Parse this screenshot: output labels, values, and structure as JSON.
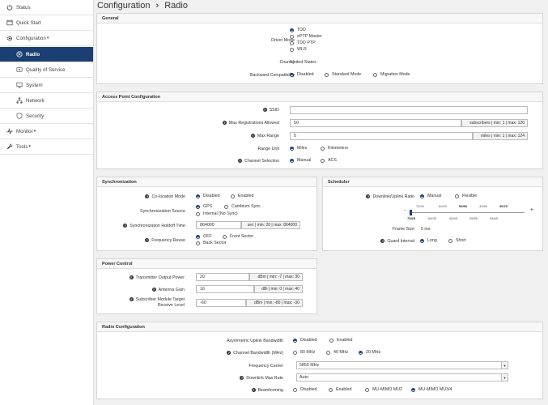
{
  "sidebar": {
    "items": [
      {
        "label": "Status",
        "icon": "power-icon"
      },
      {
        "label": "Quick Start",
        "icon": "window-icon"
      },
      {
        "label": "Configuration",
        "icon": "gear-icon"
      },
      {
        "label": "Radio",
        "icon": "radio-icon"
      },
      {
        "label": "Quality of Service",
        "icon": "qos-icon"
      },
      {
        "label": "System",
        "icon": "monitor-icon"
      },
      {
        "label": "Network",
        "icon": "network-icon"
      },
      {
        "label": "Security",
        "icon": "shield-icon"
      },
      {
        "label": "Monitor",
        "icon": "chart-icon"
      },
      {
        "label": "Tools",
        "icon": "wrench-icon"
      }
    ],
    "caret": "▾"
  },
  "page": {
    "title": "Configuration",
    "sep": "›",
    "subtitle": "Radio"
  },
  "general": {
    "title": "General",
    "driver_mode_label": "Driver Mode",
    "driver_modes": [
      "TDD",
      "ePTP Master",
      "TDD PTP",
      "WLR"
    ],
    "country_label": "Country",
    "country_value": "United States",
    "backward_label": "Backward Compatibility",
    "backward_opts": [
      "Disabled",
      "Standard Mode",
      "Migration Mode"
    ]
  },
  "ap": {
    "title": "Access Point Configuration",
    "ssid_label": "SSID",
    "ssid_value": "",
    "maxreg_label": "Max Registrations Allowed",
    "maxreg_value": "50",
    "maxreg_addon": "subscribers | min: 1 | max: 120",
    "maxrange_label": "Max Range",
    "maxrange_value": "5",
    "maxrange_addon": "miles | min: 1 | max: 124",
    "rangeunit_label": "Range Unit",
    "rangeunit_opts": [
      "Miles",
      "Kilometers"
    ],
    "chansel_label": "Channel Selection",
    "chansel_opts": [
      "Manual",
      "ACS"
    ]
  },
  "sync": {
    "title": "Synchronization",
    "coloc_label": "Co-location Mode",
    "coloc_opts": [
      "Disabled",
      "Enabled"
    ],
    "source_label": "Synchronization Source",
    "source_opts": [
      "GPS",
      "Cambium Sync",
      "Internal (No Sync)"
    ],
    "holdoff_label": "Synchronization Holdoff Time",
    "holdoff_value": "864000",
    "holdoff_addon": "sec | min: 20 | max: 864000",
    "freqreuse_label": "Frequency Reuse",
    "freqreuse_opts": [
      "OFF",
      "Front Sector",
      "Back Sector"
    ]
  },
  "sched": {
    "title": "Scheduler",
    "ratio_label": "Downlink/Uplink Ratio",
    "ratio_opts": [
      "Manual",
      "Flexible"
    ],
    "minus": "-",
    "plus": "+",
    "ticks_top": [
      "75/30",
      "60/40",
      "50/50",
      "40/60",
      "30/70"
    ],
    "ticks_bottom": [
      "75/25",
      "65/35",
      "55/45",
      "45/55",
      "35/65"
    ],
    "frame_label": "Frame Size",
    "frame_value": "5 ms",
    "guard_label": "Guard Interval",
    "guard_opts": [
      "Long",
      "Short"
    ]
  },
  "power": {
    "title": "Power Control",
    "tx_label": "Transmitter Output Power",
    "tx_value": "20",
    "tx_addon": "dBm | min: -7 | max: 30",
    "gain_label": "Antenna Gain",
    "gain_value": "16",
    "gain_addon": "dBi | min: 0 | max: 40",
    "sm_label1": "Subscriber Module Target",
    "sm_label2": "Receive Level",
    "sm_value": "-60",
    "sm_addon": "dBm | min: -80 | max: -30"
  },
  "radio": {
    "title": "Radio Configuration",
    "asym_label": "Asymmetric Uplink Bandwidth",
    "asym_opts": [
      "Disabled",
      "Enabled"
    ],
    "bw_label": "Channel Bandwidth (MHz)",
    "bw_opts": [
      "80 MHz",
      "40 MHz",
      "20 MHz"
    ],
    "carrier_label": "Frequency Carrier",
    "carrier_value": "5855 MHz",
    "dlmax_label": "Downlink Max Rate",
    "dlmax_value": "Auto",
    "bf_label": "Beamforming",
    "bf_opts": [
      "Disabled",
      "Enabled",
      "MU-MIMO MU2",
      "MU-MIMO MU3/4"
    ]
  },
  "colors": {
    "accent": "#1b3e73",
    "panel_border": "#d6d6d6",
    "background": "#f0f0f0"
  }
}
